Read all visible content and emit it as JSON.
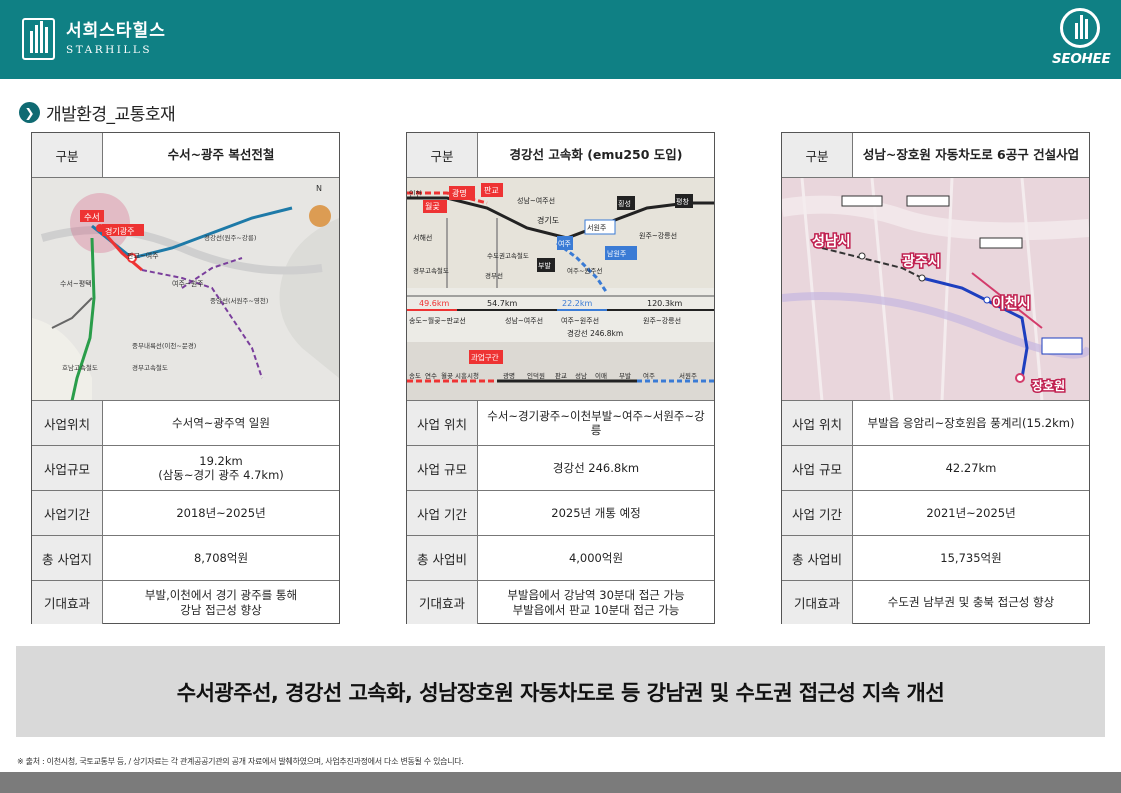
{
  "header": {
    "brand_ko": "서희스타힐스",
    "brand_en": "STARHILLS",
    "corp_logo": "SEOHEE",
    "bg_color": "#0f8084"
  },
  "section": {
    "icon": "chevron-right-icon",
    "title": "개발환경_교통호재"
  },
  "panels": [
    {
      "header_label": "구분",
      "header_title": "수서~광주 복선전철",
      "map_labels": [
        "수서",
        "경기광주",
        "판교~여주",
        "수서~평택",
        "여주~원주",
        "중앙선(서원주~영천)",
        "경강선(원주~강릉)",
        "중부내륙선(이천~문경)",
        "경부고속철도",
        "호남고속철도",
        "N"
      ],
      "rows": [
        {
          "label": "사업위치",
          "value": "수서역~광주역 일원"
        },
        {
          "label": "사업규모",
          "value": "19.2km\n(삼동~경기 광주 4.7km)"
        },
        {
          "label": "사업기간",
          "value": "2018년~2025년"
        },
        {
          "label": "총 사업지",
          "value": "8,708억원"
        },
        {
          "label": "기대효과",
          "value": "부발,이천에서 경기 광주를 통해\n강남 접근성 향상"
        }
      ]
    },
    {
      "header_label": "구분",
      "header_title": "경강선 고속화 (emu250 도입)",
      "map_labels": [
        "인천",
        "광명",
        "판교",
        "월곶",
        "성남~여주선",
        "경기도",
        "서원주",
        "횡성",
        "평창",
        "여주",
        "부발",
        "남원주",
        "원주~강릉선",
        "서해선",
        "수도권고속철도",
        "경부선",
        "경부고속철도",
        "여주~원주선",
        "49.6km",
        "54.7km",
        "22.2km",
        "120.3km",
        "송도~월곶~판교선",
        "성남~여주선",
        "여주~원주선",
        "원주~강릉선",
        "경강선 246.8km",
        "과업구간",
        "송도",
        "연수",
        "월곶",
        "시흥시청",
        "광명",
        "인덕원",
        "판교",
        "성남",
        "이매",
        "부발",
        "여주",
        "서원주"
      ],
      "rows": [
        {
          "label": "사업 위치",
          "value": "수서~경기광주~이천부발~여주~서원주~강릉"
        },
        {
          "label": "사업 규모",
          "value": "경강선 246.8km"
        },
        {
          "label": "사업 기간",
          "value": "2025년 개통 예정"
        },
        {
          "label": "총 사업비",
          "value": "4,000억원"
        },
        {
          "label": "기대효과",
          "value": "부발읍에서 강남역 30분대 접근 가능\n부발읍에서 판교 10분대 접근 가능"
        }
      ]
    },
    {
      "header_label": "구분",
      "header_title": "성남~장호원 자동차도로 6공구 건설사업",
      "map_labels": [
        "성남시",
        "광주시",
        "이천시",
        "장호원"
      ],
      "rows": [
        {
          "label": "사업 위치",
          "value": "부발읍 응암리~장호원읍 풍계리(15.2km)"
        },
        {
          "label": "사업 규모",
          "value": "42.27km"
        },
        {
          "label": "사업 기간",
          "value": "2021년~2025년"
        },
        {
          "label": "총 사업비",
          "value": "15,735억원"
        },
        {
          "label": "기대효과",
          "value": "수도권 남부권 및 충북 접근성 향상"
        }
      ]
    }
  ],
  "summary": "수서광주선, 경강선 고속화, 성남장호원 자동차도로 등 강남권 및 수도권 접근성 지속 개선",
  "footnote": "※ 출처 : 이천시청, 국토교통부 등, / 상기자료는 각 관계공공기관의 공개 자료에서 발췌하였으며, 사업추진과정에서 다소 변동될 수 있습니다."
}
